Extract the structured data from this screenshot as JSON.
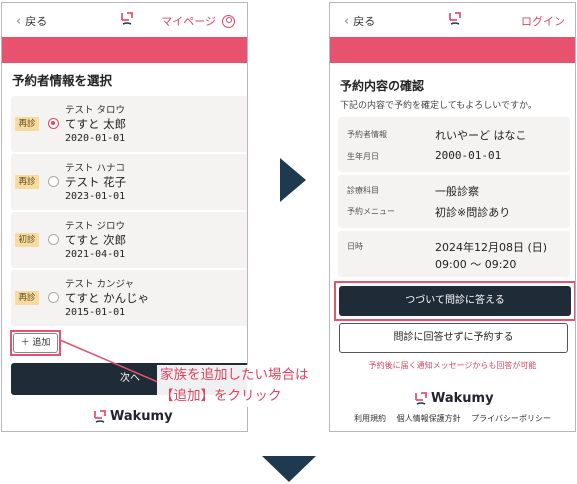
{
  "left_screen": {
    "back_label": "戻る",
    "mypage_label": "マイページ",
    "section_title": "予約者情報を選択",
    "persons": [
      {
        "badge": "再診",
        "kana": "テスト タロウ",
        "name": "てすと 太郎",
        "dob": "2020-01-01",
        "selected": true
      },
      {
        "badge": "再診",
        "kana": "テスト ハナコ",
        "name": "テスト 花子",
        "dob": "2023-01-01",
        "selected": false
      },
      {
        "badge": "初診",
        "kana": "テスト ジロウ",
        "name": "てすと 次郎",
        "dob": "2021-04-01",
        "selected": false
      },
      {
        "badge": "再診",
        "kana": "テスト カンジャ",
        "name": "てすと かんじゃ",
        "dob": "2015-01-01",
        "selected": false
      }
    ],
    "add_button": "＋ 追加",
    "next_button": "次へ",
    "footer_brand": "Wakumy"
  },
  "callout": {
    "line1": "家族を追加したい場合は",
    "line2": "【追加】をクリック"
  },
  "right_screen": {
    "back_label": "戻る",
    "login_label": "ログイン",
    "title": "予約内容の確認",
    "subtitle": "下記の内容で予約を確定してもよろしいですか。",
    "rows": {
      "reserver_label": "予約者情報",
      "reserver_value": "れいやーど はなこ",
      "dob_label": "生年月日",
      "dob_value": "2000-01-01",
      "dept_label": "診療科目",
      "dept_value": "一般診察",
      "menu_label": "予約メニュー",
      "menu_value": "初診※問診あり",
      "date_label": "日時",
      "date_value": "2024年12月08日 (日)",
      "time_value": "09:00 ～ 09:20"
    },
    "continue_button": "つづいて問診に答える",
    "no_answer_button": "問診に回答せずに予約する",
    "notice": "予約後に届く通知メッセージからも回答が可能",
    "footer_brand": "Wakumy",
    "footer_links": [
      "利用規約",
      "個人情報保護方針",
      "プライバシーポリシー"
    ]
  },
  "colors": {
    "accent": "#e7536e",
    "dark_button": "#1f2b36",
    "arrow": "#1f3a4f",
    "badge": "#f8dc9f",
    "card_bg": "#f5f3f1"
  }
}
